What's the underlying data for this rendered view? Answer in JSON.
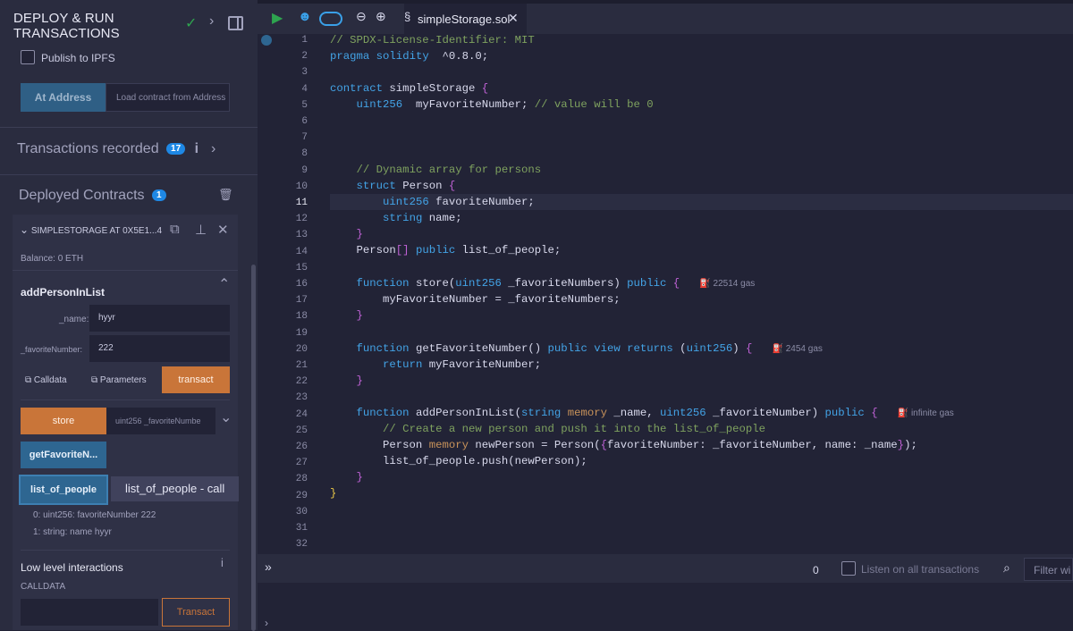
{
  "sidebar": {
    "title_line1": "DEPLOY & RUN",
    "title_line2": "TRANSACTIONS",
    "publish_label": "Publish to IPFS",
    "at_address_label": "At Address",
    "at_address_placeholder": "Load contract from Address",
    "transactions_label": "Transactions recorded",
    "transactions_count": "17",
    "deployed_label": "Deployed Contracts",
    "deployed_count": "1",
    "instance_label": "SIMPLESTORAGE AT 0X5E1...4",
    "balance": "Balance: 0 ETH",
    "function_title": "addPersonInList",
    "name_label": "_name:",
    "name_value": "hyyr",
    "fav_label": "_favoriteNumber:",
    "fav_value": "222",
    "calldata_label": "Calldata",
    "parameters_label": "Parameters",
    "transact_label": "transact",
    "store_label": "store",
    "store_placeholder": "uint256 _favoriteNumbe",
    "getfav_label": "getFavoriteN...",
    "list_label": "list_of_people",
    "tooltip": "list_of_people - call",
    "result0": "0: uint256: favoriteNumber 222",
    "result1": "1: string: name hyyr",
    "low_level_label": "Low level interactions",
    "calldata_header": "CALLDATA",
    "transact_btn": "Transact"
  },
  "editor": {
    "tab_title": "simpleStorage.sol",
    "lines": [
      "1",
      "2",
      "3",
      "4",
      "5",
      "6",
      "7",
      "8",
      "9",
      "10",
      "11",
      "12",
      "13",
      "14",
      "15",
      "16",
      "17",
      "18",
      "19",
      "20",
      "21",
      "22",
      "23",
      "24",
      "25",
      "26",
      "27",
      "28",
      "29",
      "30",
      "31",
      "32"
    ],
    "gas_store": "22514 gas",
    "gas_get": "2454 gas",
    "gas_add": "infinite gas"
  },
  "terminal": {
    "count": "0",
    "listen_label": "Listen on all transactions",
    "filter_placeholder": "Filter wi"
  },
  "colors": {
    "accent_blue": "#2e6691",
    "accent_orange": "#c97539",
    "badge_blue": "#1e88e5"
  }
}
